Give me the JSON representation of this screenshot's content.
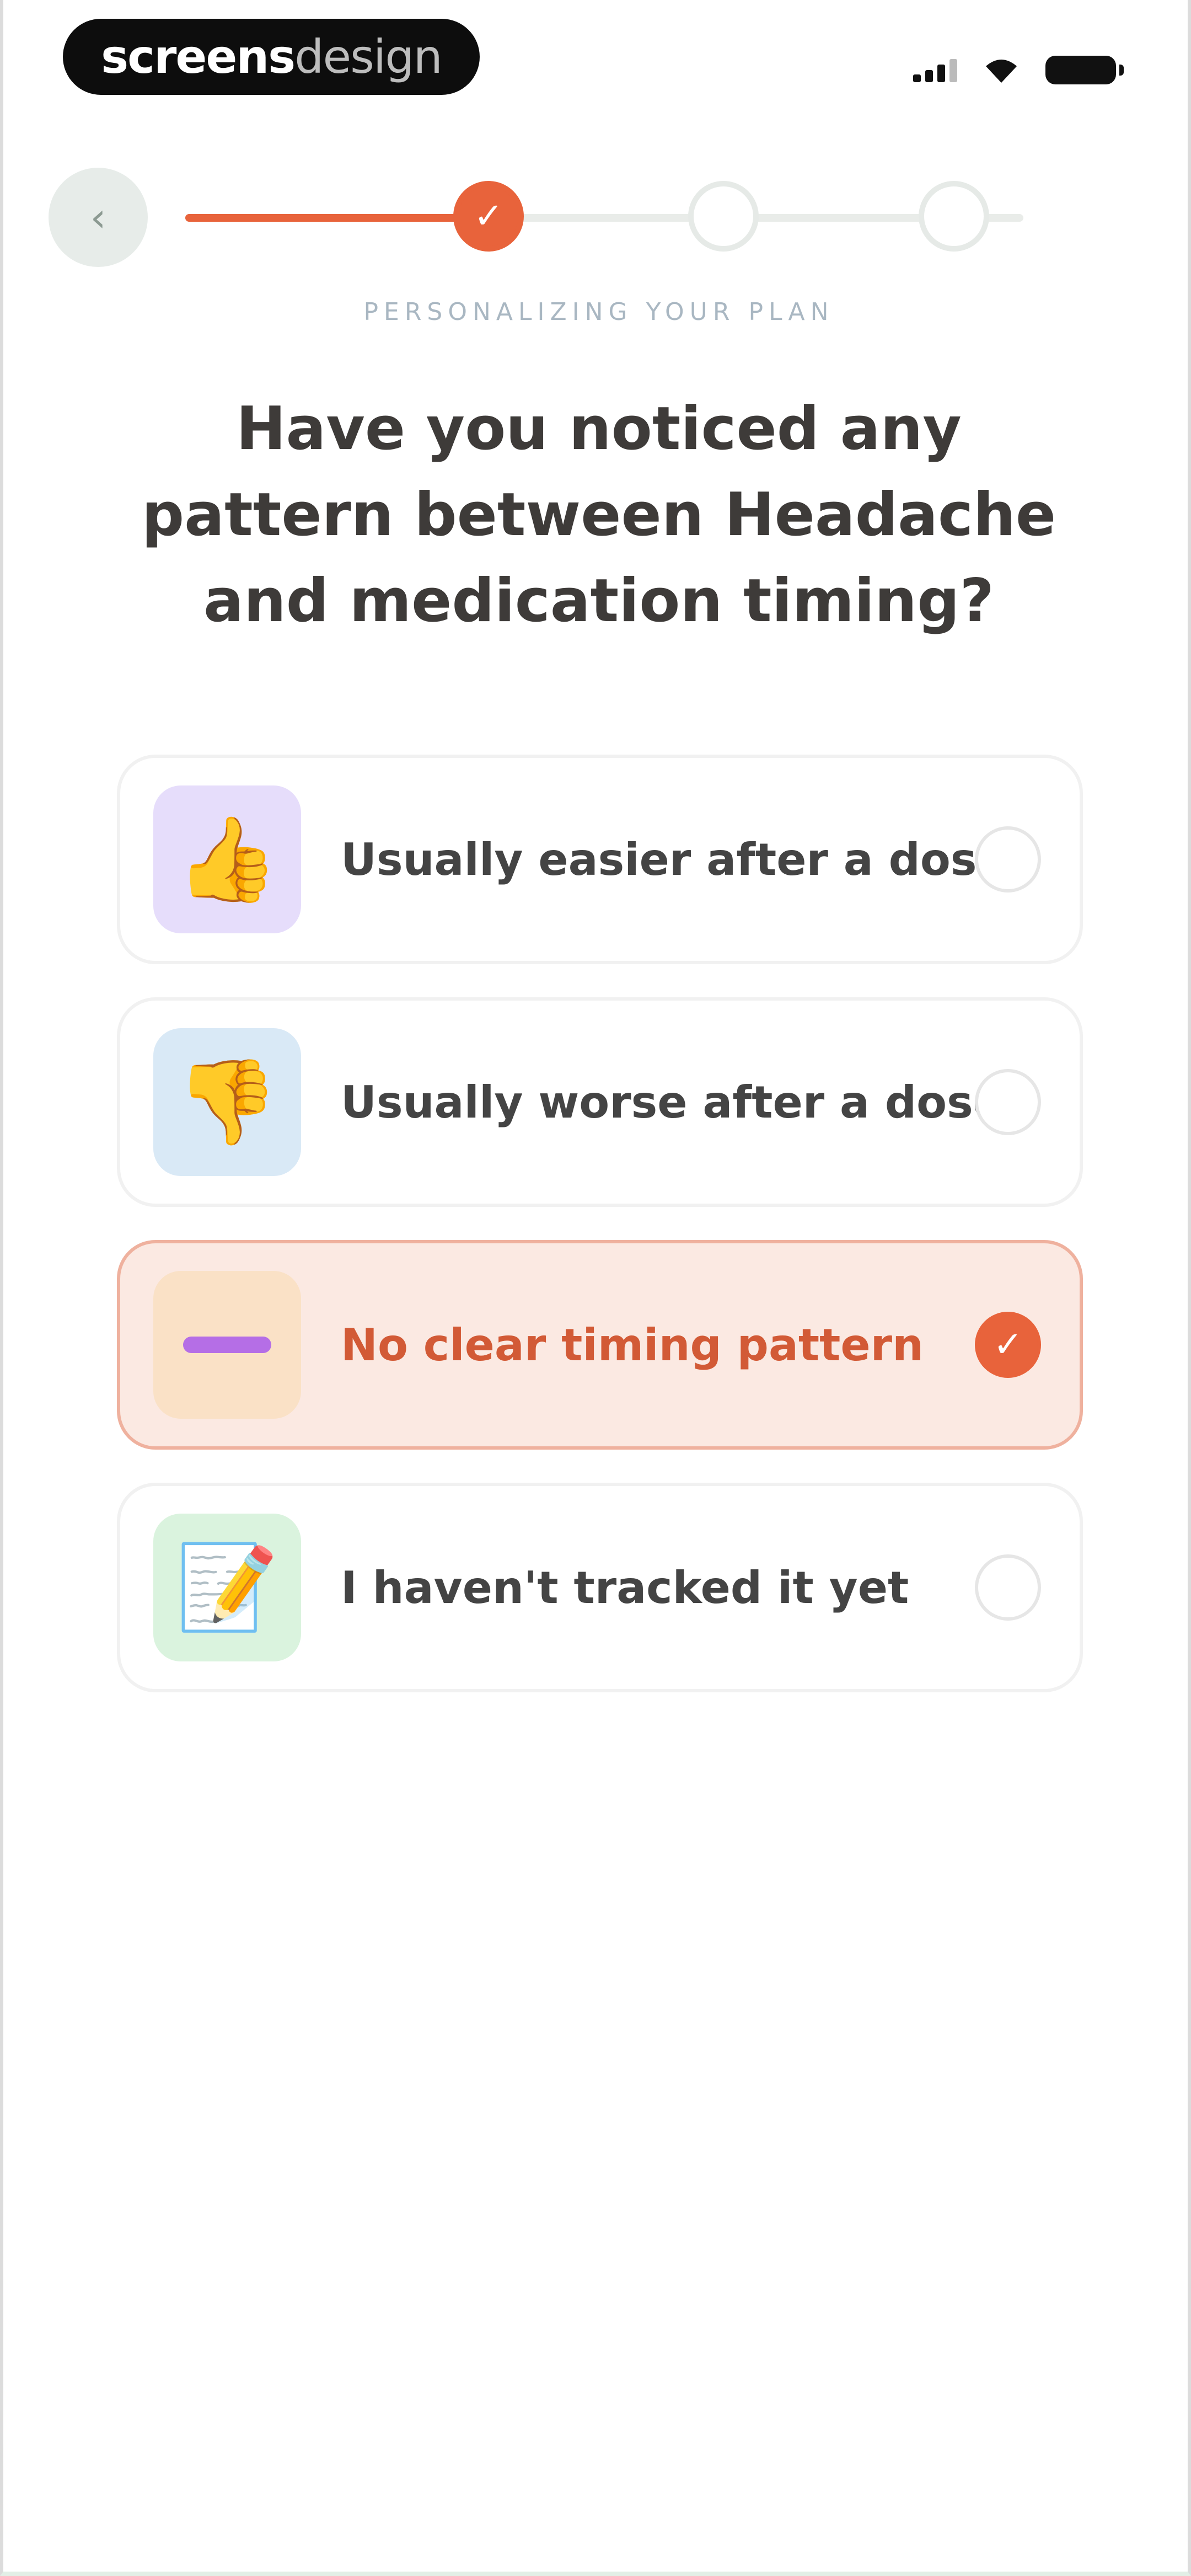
{
  "status_bar": {
    "brand_bold": "screens",
    "brand_light": "design"
  },
  "header": {
    "back_icon": "chevron-left-icon",
    "progress": {
      "steps": 3,
      "completed": 1,
      "fill_fraction": 0.34
    },
    "stage_label": "PERSONALIZING YOUR PLAN"
  },
  "question": "Have you noticed any pattern between Headache and medication timing?",
  "colors": {
    "accent": "#e8633b",
    "selected_bg": "#fbe9e2",
    "icon_bg_purple": "#e6ddfb",
    "icon_bg_blue": "#d9e9f6",
    "icon_bg_peach": "#fae1c6",
    "icon_bg_green": "#daf3de"
  },
  "options": [
    {
      "label": "Usually easier after a dose",
      "icon": "thumbs-up-icon",
      "selected": false
    },
    {
      "label": "Usually worse after a dose",
      "icon": "thumbs-down-icon",
      "selected": false
    },
    {
      "label": "No clear timing pattern",
      "icon": "dash-icon",
      "selected": true
    },
    {
      "label": "I haven't tracked it yet",
      "icon": "memo-icon",
      "selected": false
    }
  ]
}
